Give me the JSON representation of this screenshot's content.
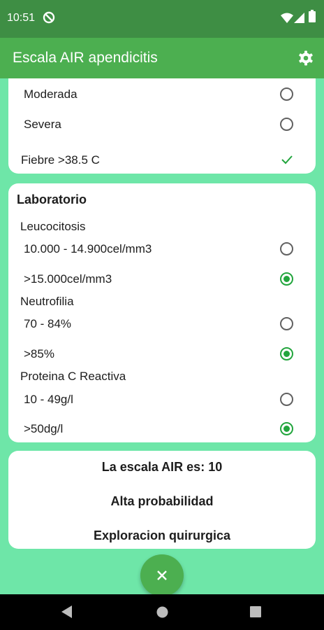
{
  "status": {
    "time": "10:51"
  },
  "appbar": {
    "title": "Escala AIR apendicitis"
  },
  "card1": {
    "options": [
      {
        "label": "Moderada",
        "selected": false
      },
      {
        "label": "Severa",
        "selected": false
      }
    ],
    "fever": {
      "label": "Fiebre >38.5 C",
      "checked": true
    }
  },
  "lab": {
    "title": "Laboratorio",
    "groups": [
      {
        "name": "Leucocitosis",
        "options": [
          {
            "label": "10.000 - 14.900cel/mm3",
            "selected": false
          },
          {
            "label": ">15.000cel/mm3",
            "selected": true
          }
        ]
      },
      {
        "name": "Neutrofilia",
        "options": [
          {
            "label": "70 - 84%",
            "selected": false
          },
          {
            "label": ">85%",
            "selected": true
          }
        ]
      },
      {
        "name": "Proteina C Reactiva",
        "options": [
          {
            "label": "10 - 49g/l",
            "selected": false
          },
          {
            "label": ">50dg/l",
            "selected": true
          }
        ]
      }
    ]
  },
  "result": {
    "score_text": "La escala AIR es: 10",
    "probability": "Alta probabilidad",
    "recommendation": "Exploracion quirurgica"
  },
  "colors": {
    "statusbar": "#3e8e44",
    "appbar": "#4caf50",
    "background": "#6ee6a8",
    "accent": "#22a53d"
  },
  "icons": {
    "settings": "gear-icon",
    "fab": "close-icon"
  }
}
